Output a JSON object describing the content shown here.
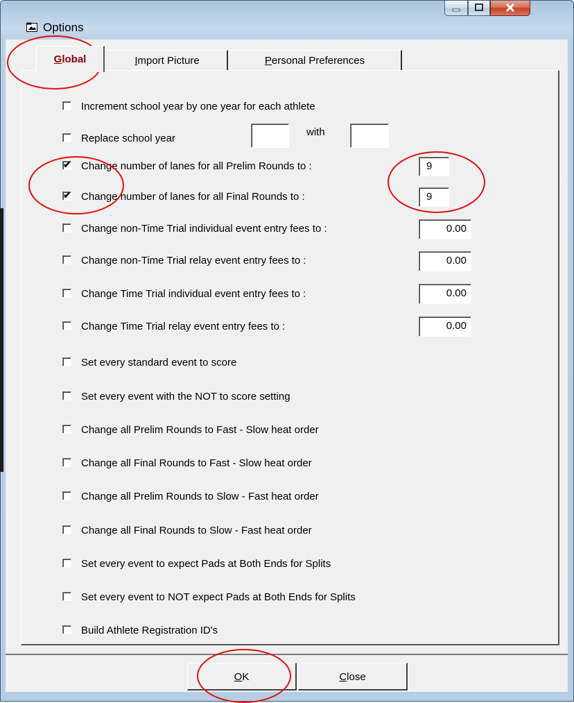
{
  "window": {
    "title": "Options"
  },
  "tabs": [
    {
      "label": "Global",
      "mnemonic": "G",
      "rest": "lobal",
      "selected": true
    },
    {
      "label": "Import Picture",
      "mnemonic": "I",
      "rest": "mport Picture"
    },
    {
      "label": "Personal Preferences",
      "mnemonic": "P",
      "rest": "ersonal Preferences"
    }
  ],
  "options": [
    {
      "label": "Increment school year by one year for each athlete",
      "checked": false
    },
    {
      "label": "Replace school year",
      "checked": false,
      "with_label": "with",
      "from_value": "",
      "to_value": ""
    },
    {
      "label": "Change number of lanes for all Prelim Rounds to :",
      "checked": true,
      "value": "9"
    },
    {
      "label": "Change number of lanes for all Final Rounds to :",
      "checked": true,
      "value": "9"
    },
    {
      "label": "Change non-Time Trial individual event entry fees to :",
      "checked": false,
      "value": "0.00"
    },
    {
      "label": "Change non-Time Trial relay event entry fees to :",
      "checked": false,
      "value": "0.00"
    },
    {
      "label": "Change Time Trial individual event entry fees to :",
      "checked": false,
      "value": "0.00"
    },
    {
      "label": "Change Time Trial relay event entry fees to :",
      "checked": false,
      "value": "0.00"
    },
    {
      "label": "Set every standard event to score",
      "checked": false
    },
    {
      "label": "Set every event with the NOT to score setting",
      "checked": false
    },
    {
      "label": "Change all Prelim Rounds to Fast - Slow heat order",
      "checked": false
    },
    {
      "label": "Change all Final Rounds to Fast - Slow heat order",
      "checked": false
    },
    {
      "label": "Change all Prelim Rounds to Slow - Fast heat order",
      "checked": false
    },
    {
      "label": "Change all Final Rounds to Slow - Fast heat order",
      "checked": false
    },
    {
      "label": "Set every event to expect Pads at Both Ends for Splits",
      "checked": false
    },
    {
      "label": "Set every event to NOT expect Pads at Both Ends for Splits",
      "checked": false
    },
    {
      "label": "Build Athlete Registration ID's",
      "checked": false
    }
  ],
  "buttons": {
    "ok": {
      "label": "OK",
      "mnemonic": "O",
      "rest": "K"
    },
    "close": {
      "label": "Close",
      "mnemonic": "C",
      "rest": "lose"
    }
  },
  "colors": {
    "annotation": "#e01010",
    "selected_tab_text": "#8b0000"
  }
}
